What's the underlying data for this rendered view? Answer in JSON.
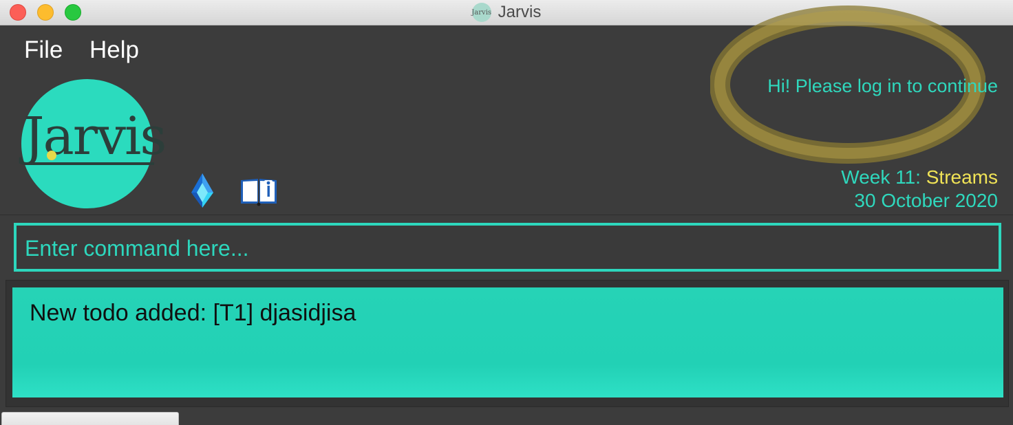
{
  "window": {
    "title": "Jarvis",
    "title_icon_text": "Jarvis",
    "controls": [
      "close",
      "minimize",
      "zoom"
    ]
  },
  "menu": {
    "file_label": "File",
    "help_label": "Help"
  },
  "logo": {
    "text": "Jarvis",
    "color": "#2bdbbe"
  },
  "icons": {
    "gem": "gem-icon",
    "book": "book-info-icon"
  },
  "header": {
    "greeting": "Hi! Please log in to continue",
    "week_label": "Week 11:",
    "week_topic": "Streams",
    "date": "30 October 2020"
  },
  "command": {
    "placeholder": "Enter command here...",
    "value": ""
  },
  "result": {
    "message": "New todo added: [T1] djasidjisa"
  },
  "colors": {
    "accent": "#2dd7bd",
    "background": "#3c3c3c",
    "highlight": "#f0e356",
    "result_bg": "#22d1b5"
  }
}
